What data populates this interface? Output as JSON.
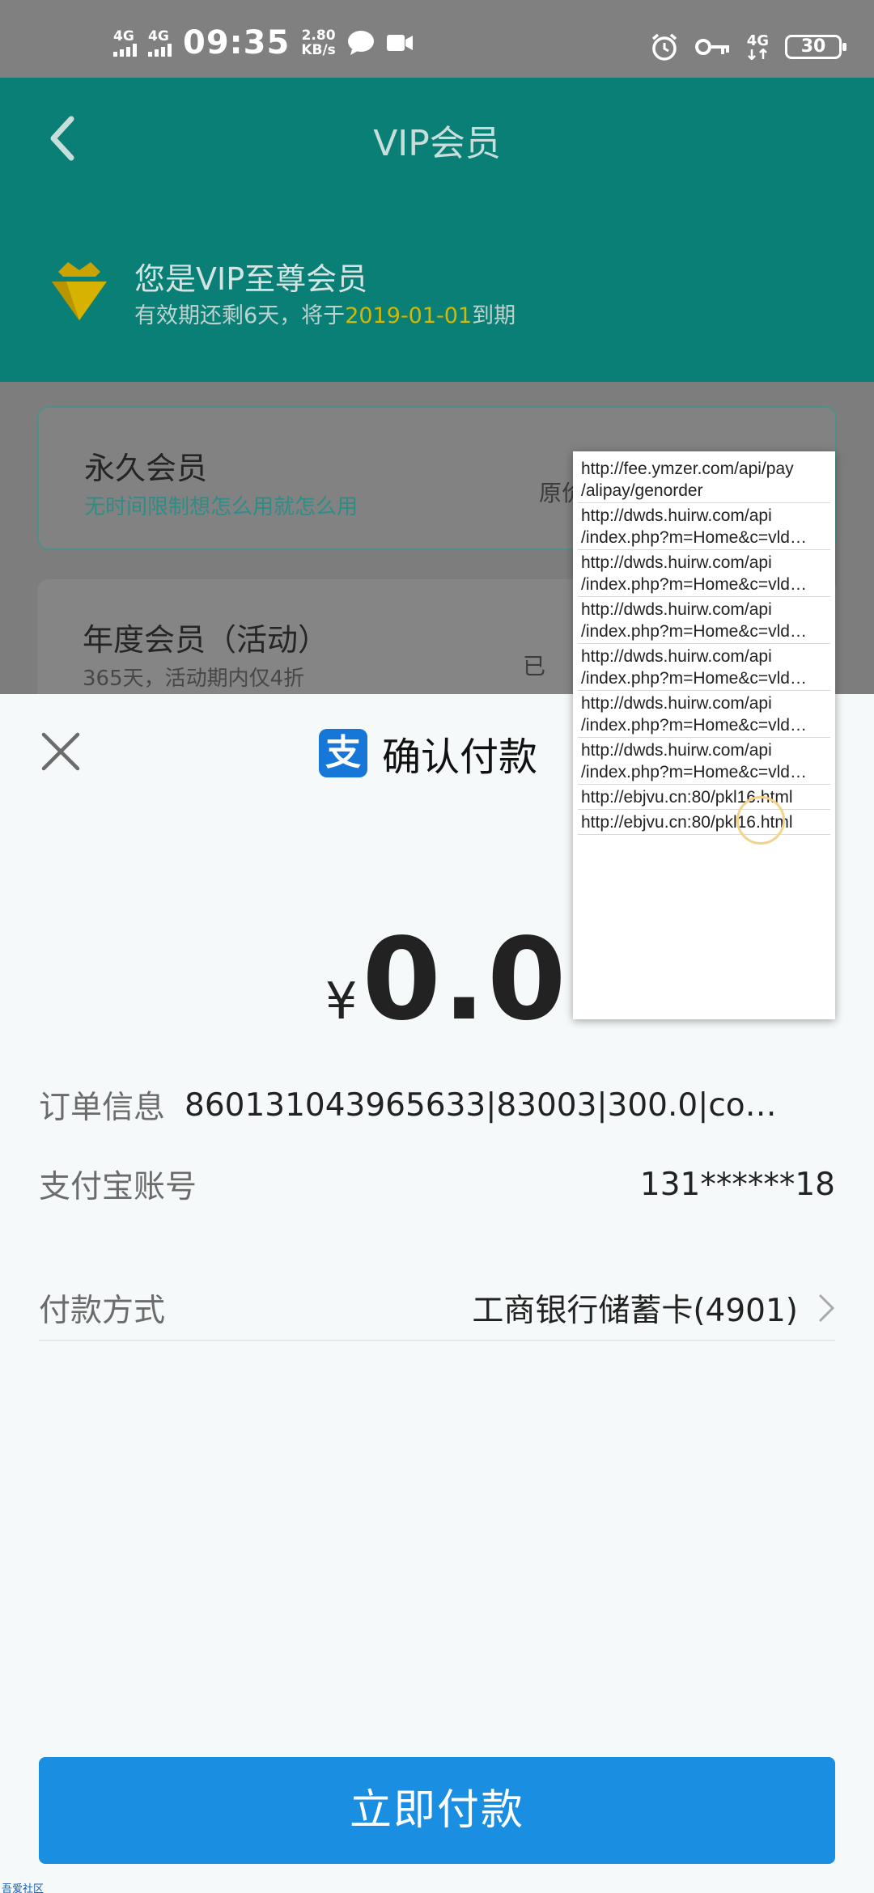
{
  "status_bar": {
    "sim1": "4G",
    "sim2": "4G",
    "time": "09:35",
    "speed_value": "2.80",
    "speed_unit": "KB/s",
    "net": "4G",
    "battery": "30"
  },
  "header": {
    "title": "VIP会员",
    "vip_title": "您是VIP至尊会员",
    "vip_prefix": "有效期还剩6天，将于",
    "vip_date": "2019-01-01",
    "vip_suffix": "到期"
  },
  "plans": [
    {
      "title": "永久会员",
      "subtitle": "无时间限制想怎么用就怎么用",
      "price_label": "原价"
    },
    {
      "title": "年度会员（活动）",
      "subtitle": "365天，活动期内仅4折",
      "price_label": "已"
    }
  ],
  "payment": {
    "logo_char": "支",
    "title": "确认付款",
    "currency": "¥",
    "amount": "0.01",
    "order_label": "订单信息",
    "order_value": "860131043965633|83003|300.0|co…",
    "account_label": "支付宝账号",
    "account_value": "131******18",
    "method_label": "付款方式",
    "method_value": "工商银行储蓄卡(4901)",
    "pay_button": "立即付款"
  },
  "url_popup": [
    {
      "line1": "http://fee.ymzer.com/api/pay",
      "line2": "/alipay/genorder"
    },
    {
      "line1": "http://dwds.huirw.com/api",
      "line2": "/index.php?m=Home&c=vld…"
    },
    {
      "line1": "http://dwds.huirw.com/api",
      "line2": "/index.php?m=Home&c=vld…"
    },
    {
      "line1": "http://dwds.huirw.com/api",
      "line2": "/index.php?m=Home&c=vld…"
    },
    {
      "line1": "http://dwds.huirw.com/api",
      "line2": "/index.php?m=Home&c=vld…"
    },
    {
      "line1": "http://dwds.huirw.com/api",
      "line2": "/index.php?m=Home&c=vld…"
    },
    {
      "line1": "http://dwds.huirw.com/api",
      "line2": "/index.php?m=Home&c=vld…"
    },
    {
      "line1": "http://ebjvu.cn:80/pkl16.html",
      "line2": ""
    },
    {
      "line1": "http://ebjvu.cn:80/pkl16.html",
      "line2": ""
    }
  ],
  "watermark": "吾爱社区",
  "colors": {
    "header_bg": "#0a7f76",
    "alipay_blue": "#1677d9",
    "pay_button": "#1a8ee0",
    "date_highlight": "#d4b700"
  }
}
